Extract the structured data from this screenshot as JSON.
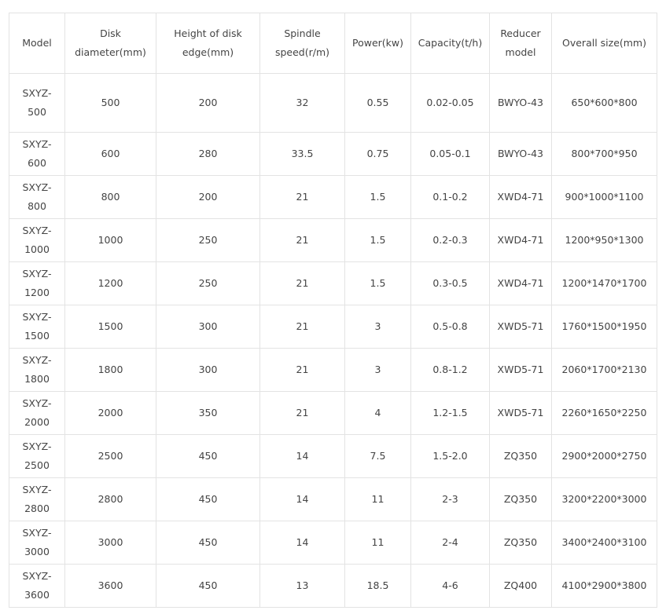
{
  "table": {
    "headers": [
      "Model",
      "Disk diameter(mm)",
      "Height of disk edge(mm)",
      "Spindle speed(r/m)",
      "Power(kw)",
      "Capacity(t/h)",
      "Reducer model",
      "Overall size(mm)"
    ],
    "rows": [
      {
        "model_a": "SXYZ-",
        "model_b": "500",
        "diameter": "500",
        "edge": "200",
        "speed": "32",
        "power": "0.55",
        "capacity": "0.02-0.05",
        "reducer": "BWYO-43",
        "size": "650*600*800"
      },
      {
        "model_a": "SXYZ-",
        "model_b": "600",
        "diameter": "600",
        "edge": "280",
        "speed": "33.5",
        "power": "0.75",
        "capacity": "0.05-0.1",
        "reducer": "BWYO-43",
        "size": "800*700*950"
      },
      {
        "model_a": "SXYZ-",
        "model_b": "800",
        "diameter": "800",
        "edge": "200",
        "speed": "21",
        "power": "1.5",
        "capacity": "0.1-0.2",
        "reducer": "XWD4-71",
        "size": "900*1000*1100"
      },
      {
        "model_a": "SXYZ-",
        "model_b": "1000",
        "diameter": "1000",
        "edge": "250",
        "speed": "21",
        "power": "1.5",
        "capacity": "0.2-0.3",
        "reducer": "XWD4-71",
        "size": "1200*950*1300"
      },
      {
        "model_a": "SXYZ-",
        "model_b": "1200",
        "diameter": "1200",
        "edge": "250",
        "speed": "21",
        "power": "1.5",
        "capacity": "0.3-0.5",
        "reducer": "XWD4-71",
        "size": "1200*1470*1700"
      },
      {
        "model_a": "SXYZ-",
        "model_b": "1500",
        "diameter": "1500",
        "edge": "300",
        "speed": "21",
        "power": "3",
        "capacity": "0.5-0.8",
        "reducer": "XWD5-71",
        "size": "1760*1500*1950"
      },
      {
        "model_a": "SXYZ-",
        "model_b": "1800",
        "diameter": "1800",
        "edge": "300",
        "speed": "21",
        "power": "3",
        "capacity": "0.8-1.2",
        "reducer": "XWD5-71",
        "size": "2060*1700*2130"
      },
      {
        "model_a": "SXYZ-",
        "model_b": "2000",
        "diameter": "2000",
        "edge": "350",
        "speed": "21",
        "power": "4",
        "capacity": "1.2-1.5",
        "reducer": "XWD5-71",
        "size": "2260*1650*2250"
      },
      {
        "model_a": "SXYZ-",
        "model_b": "2500",
        "diameter": "2500",
        "edge": "450",
        "speed": "14",
        "power": "7.5",
        "capacity": "1.5-2.0",
        "reducer": "ZQ350",
        "size": "2900*2000*2750"
      },
      {
        "model_a": "SXYZ-",
        "model_b": "2800",
        "diameter": "2800",
        "edge": "450",
        "speed": "14",
        "power": "11",
        "capacity": "2-3",
        "reducer": "ZQ350",
        "size": "3200*2200*3000"
      },
      {
        "model_a": "SXYZ-",
        "model_b": "3000",
        "diameter": "3000",
        "edge": "450",
        "speed": "14",
        "power": "11",
        "capacity": "2-4",
        "reducer": "ZQ350",
        "size": "3400*2400*3100"
      },
      {
        "model_a": "SXYZ-",
        "model_b": "3600",
        "diameter": "3600",
        "edge": "450",
        "speed": "13",
        "power": "18.5",
        "capacity": "4-6",
        "reducer": "ZQ400",
        "size": "4100*2900*3800"
      }
    ]
  }
}
